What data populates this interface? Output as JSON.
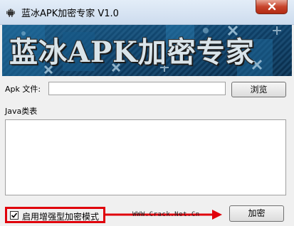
{
  "window": {
    "title": "蓝冰APK加密专家 V1.0",
    "app_icon": "android-icon",
    "close_icon": "close-icon"
  },
  "banner": {
    "text": "蓝冰APK加密专家"
  },
  "form": {
    "apk_file_label": "Apk 文件:",
    "apk_file_value": "",
    "browse_button": "浏览",
    "java_class_label": "Java类表",
    "java_class_items": []
  },
  "footer": {
    "enhanced_mode_label": "启用增强型加密模式",
    "enhanced_mode_checked": true,
    "watermark": "WWW.Crack.Net.Cn",
    "encrypt_button": "加密"
  },
  "annotation": {
    "color": "#e0000b"
  }
}
